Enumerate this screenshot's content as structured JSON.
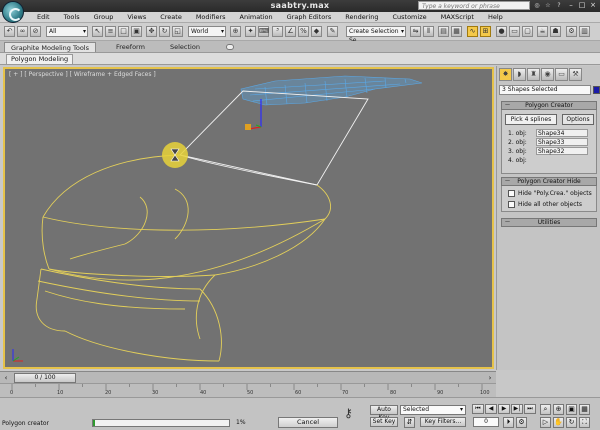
{
  "window": {
    "title": "saabtry.max",
    "search_placeholder": "Type a keyword or phrase"
  },
  "menu": [
    "Edit",
    "Tools",
    "Group",
    "Views",
    "Create",
    "Modifiers",
    "Animation",
    "Graph Editors",
    "Rendering",
    "Customize",
    "MAXScript",
    "Help"
  ],
  "toolbar": {
    "selection_filter": "All",
    "reference_coord": "World",
    "named_selection": "Create Selection Se"
  },
  "ribbon": {
    "tabs": [
      "Graphite Modeling Tools",
      "Freeform",
      "Selection"
    ],
    "panel_label": "Polygon Modeling"
  },
  "viewport": {
    "label": "[ + ] [ Perspective ] [ Wireframe + Edged Faces ]"
  },
  "command_panel": {
    "object_name": "3 Shapes Selected",
    "swatch_color": "#1a1aa8",
    "rollout_creator": "Polygon Creator",
    "pick_button": "Pick 4 splines",
    "options_button": "Options",
    "objects": [
      {
        "label": "1. obj:",
        "value": "Shape34"
      },
      {
        "label": "2. obj:",
        "value": "Shape33"
      },
      {
        "label": "3. obj:",
        "value": "Shape32"
      },
      {
        "label": "4. obj:",
        "value": ""
      }
    ],
    "rollout_hide": "Polygon Creator Hide",
    "checkbox_hide_poly": "Hide \"Poly.Crea.\" objects",
    "checkbox_hide_others": "Hide all other objects",
    "rollout_utilities": "Utilities"
  },
  "time_slider": {
    "position": "0 / 100",
    "ticks": [
      "0",
      "10",
      "20",
      "30",
      "40",
      "50",
      "60",
      "70",
      "80",
      "90",
      "100"
    ]
  },
  "status": {
    "text": "Polygon creator",
    "progress_percent": "1%",
    "progress_value": 0.01,
    "cancel_label": "Cancel",
    "auto_key": "Auto Key",
    "set_key": "Set Key",
    "key_mode": "Selected",
    "key_filters": "Key Filters...",
    "frame": "0"
  },
  "colors": {
    "viewport_border": "#e5c24a",
    "spline": "#e3cf5a",
    "roof_mesh": "#5aa9e8",
    "cursor_highlight": "#e8d23a"
  }
}
